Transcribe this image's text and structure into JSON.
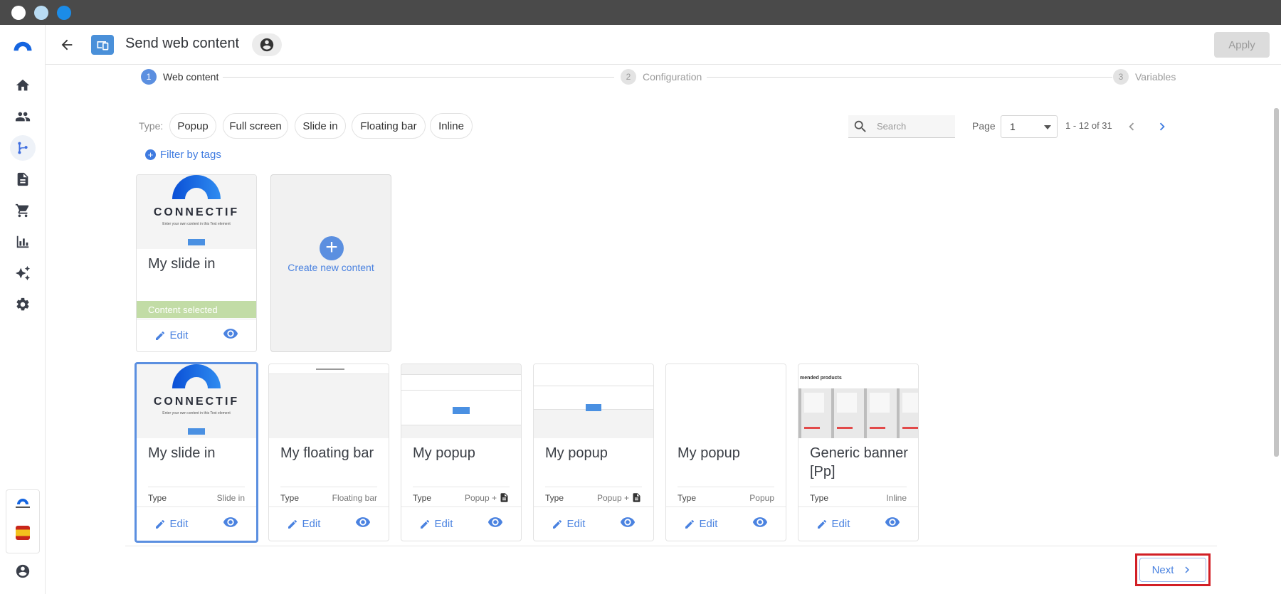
{
  "header": {
    "title": "Send web content",
    "apply_label": "Apply"
  },
  "stepper": {
    "steps": [
      {
        "number": "1",
        "label": "Web content",
        "state": "active"
      },
      {
        "number": "2",
        "label": "Configuration",
        "state": "inactive"
      },
      {
        "number": "3",
        "label": "Variables",
        "state": "inactive"
      }
    ]
  },
  "filters": {
    "type_label": "Type:",
    "chips": [
      "Popup",
      "Full screen",
      "Slide in",
      "Floating bar",
      "Inline"
    ],
    "filter_by_tags": "Filter by tags",
    "search_placeholder": "Search"
  },
  "pagination": {
    "page_label": "Page",
    "page_value": "1",
    "range": "1 - 12 of 31"
  },
  "selected_card": {
    "title": "My slide in",
    "status": "Content selected",
    "edit_label": "Edit",
    "thumb_brand": "CONNECTIF",
    "thumb_text": "Enter your own content in this Text element",
    "thumb_button": "button"
  },
  "create_card": {
    "label": "Create new content"
  },
  "cards": [
    {
      "title": "My slide in",
      "type_key": "Type",
      "type_value": "Slide in",
      "edit_label": "Edit",
      "has_doc_icon": false
    },
    {
      "title": "My floating bar",
      "type_key": "Type",
      "type_value": "Floating bar",
      "edit_label": "Edit",
      "has_doc_icon": false
    },
    {
      "title": "My popup",
      "type_key": "Type",
      "type_value": "Popup +",
      "edit_label": "Edit",
      "has_doc_icon": true
    },
    {
      "title": "My popup",
      "type_key": "Type",
      "type_value": "Popup +",
      "edit_label": "Edit",
      "has_doc_icon": true
    },
    {
      "title": "My popup",
      "type_key": "Type",
      "type_value": "Popup",
      "edit_label": "Edit",
      "has_doc_icon": false
    },
    {
      "title": "Generic banner [Pp]",
      "type_key": "Type",
      "type_value": "Inline",
      "edit_label": "Edit",
      "has_doc_icon": false,
      "thumb_text": "mended products"
    }
  ],
  "footer": {
    "next_label": "Next"
  },
  "colors": {
    "accent": "#5b8fe0",
    "link": "#4a82e0",
    "selected_bar": "#c2dca6",
    "highlight_outline": "#d21f26"
  }
}
